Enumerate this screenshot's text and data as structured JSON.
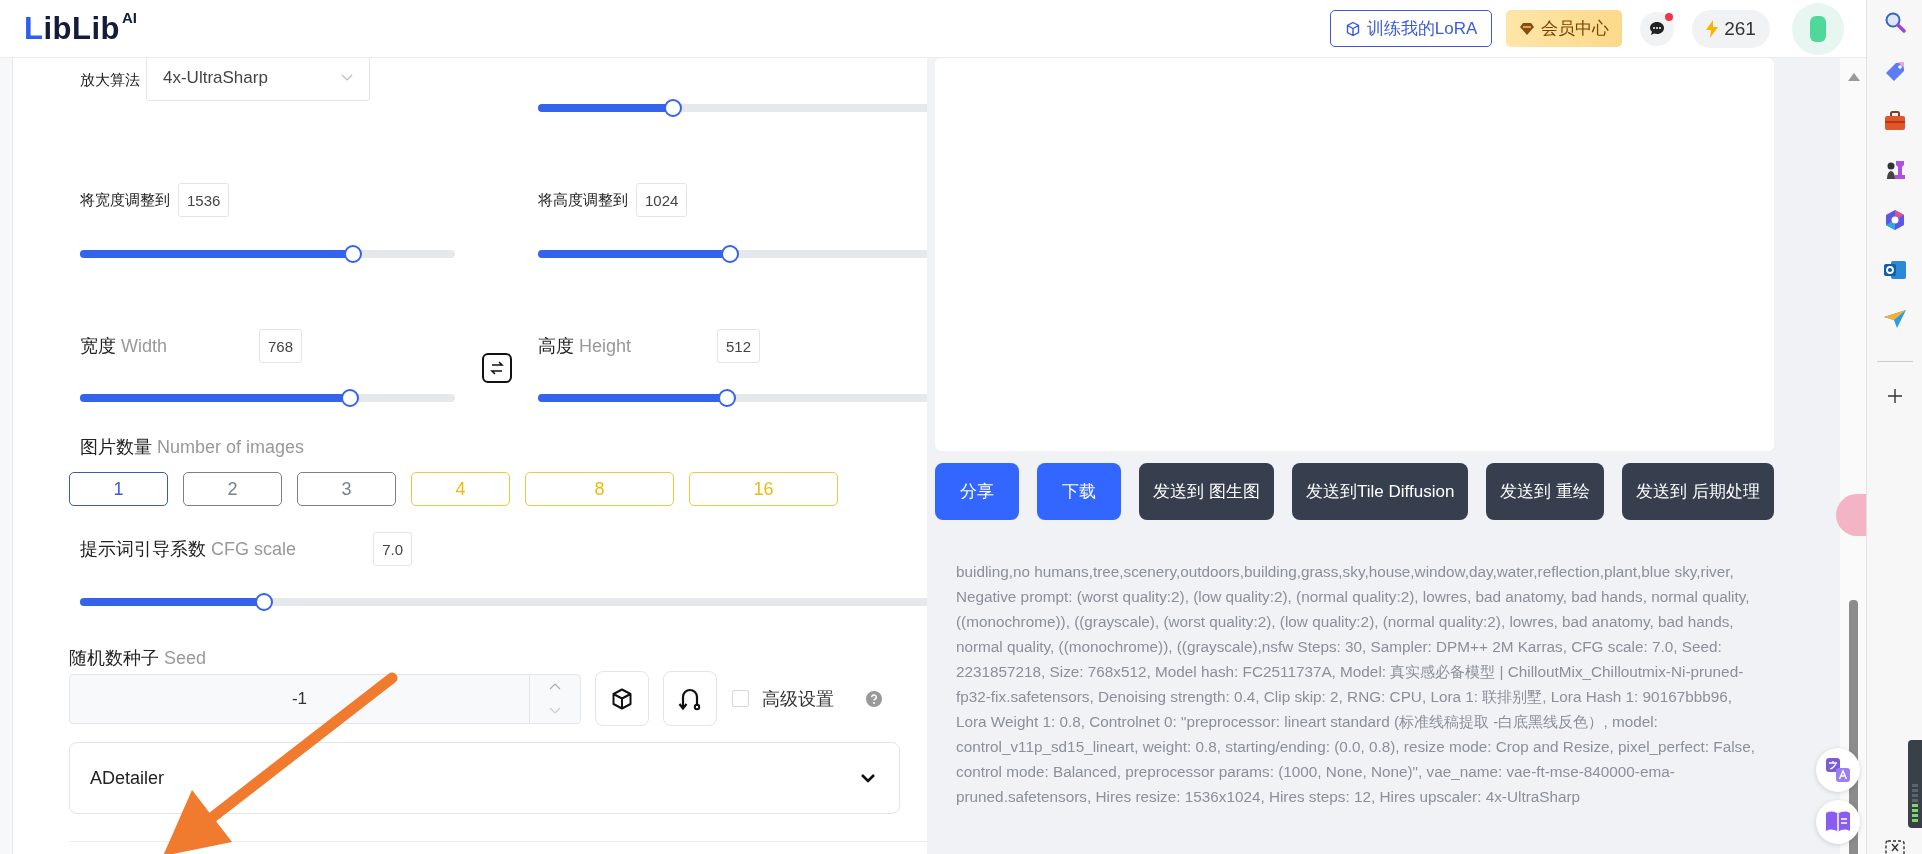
{
  "header": {
    "logo": "LibLib",
    "logo_suffix": "AI",
    "train_button": "训练我的LoRA",
    "vip_button": "会员中心",
    "chat_unread": true,
    "credits": "261"
  },
  "upscaler": {
    "label": "放大算法",
    "value": "4x-UltraSharp"
  },
  "scale_slider": {
    "level": 0.33
  },
  "resize": [
    {
      "label": "将宽度调整到",
      "value": "1536",
      "level": 0.74
    },
    {
      "label": "将高度调整到",
      "value": "1024",
      "level": 0.48
    }
  ],
  "size": [
    {
      "label": "宽度",
      "label_en": "Width",
      "value": "768",
      "level": 0.73
    },
    {
      "label": "高度",
      "label_en": "Height",
      "value": "512",
      "level": 0.47
    }
  ],
  "image_count": {
    "label": "图片数量",
    "label_en": "Number of images",
    "options": [
      {
        "label": "1",
        "kind": "standard",
        "selected": true
      },
      {
        "label": "2",
        "kind": "standard",
        "selected": false
      },
      {
        "label": "3",
        "kind": "standard",
        "selected": false
      },
      {
        "label": "4",
        "kind": "premium",
        "selected": false
      },
      {
        "label": "8",
        "kind": "premium",
        "selected": false
      },
      {
        "label": "16",
        "kind": "premium",
        "selected": false
      }
    ]
  },
  "cfg": {
    "label": "提示词引导系数",
    "label_en": "CFG scale",
    "value": "7.0",
    "level": 0.21
  },
  "seed": {
    "label": "随机数种子",
    "label_en": "Seed",
    "value": "-1",
    "advanced": {
      "label": "高级设置",
      "checked": false
    }
  },
  "adetailer": {
    "label": "ADetailer",
    "expanded": false
  },
  "actions": [
    {
      "label": "分享",
      "kind": "primary"
    },
    {
      "label": "下载",
      "kind": "primary"
    },
    {
      "label": "发送到 图生图",
      "kind": "secondary"
    },
    {
      "label": "发送到Tile Diffusion",
      "kind": "secondary"
    },
    {
      "label": "发送到 重绘",
      "kind": "secondary"
    },
    {
      "label": "发送到 后期处理",
      "kind": "secondary"
    }
  ],
  "generation_info": "buidling,no humans,tree,scenery,outdoors,building,grass,sky,house,window,day,water,reflection,plant,blue sky,river, Negative prompt: (worst quality:2), (low quality:2), (normal quality:2), lowres, bad anatomy, bad hands, normal quality, ((monochrome)), ((grayscale), (worst quality:2), (low quality:2), (normal quality:2), lowres, bad anatomy, bad hands, normal quality, ((monochrome)), ((grayscale),nsfw Steps: 30, Sampler: DPM++ 2M Karras, CFG scale: 7.0, Seed: 2231857218, Size: 768x512, Model hash: FC2511737A, Model: 真实感必备模型 | ChilloutMix_Chilloutmix-Ni-pruned-fp32-fix.safetensors, Denoising strength: 0.4, Clip skip: 2, RNG: CPU, Lora 1: 联排别墅, Lora Hash 1: 90167bbb96, Lora Weight 1: 0.8, Controlnet 0: \"preprocessor: lineart standard (标准线稿提取 -白底黑线反色）, model: control_v11p_sd15_lineart, weight: 0.8, starting/ending: (0.0, 0.8), resize mode: Crop and Resize, pixel_perfect: False, control mode: Balanced, preprocessor params: (1000, None, None)\", vae_name: vae-ft-mse-840000-ema-pruned.safetensors, Hires resize: 1536x1024, Hires steps: 12, Hires upscaler: 4x-UltraSharp"
}
